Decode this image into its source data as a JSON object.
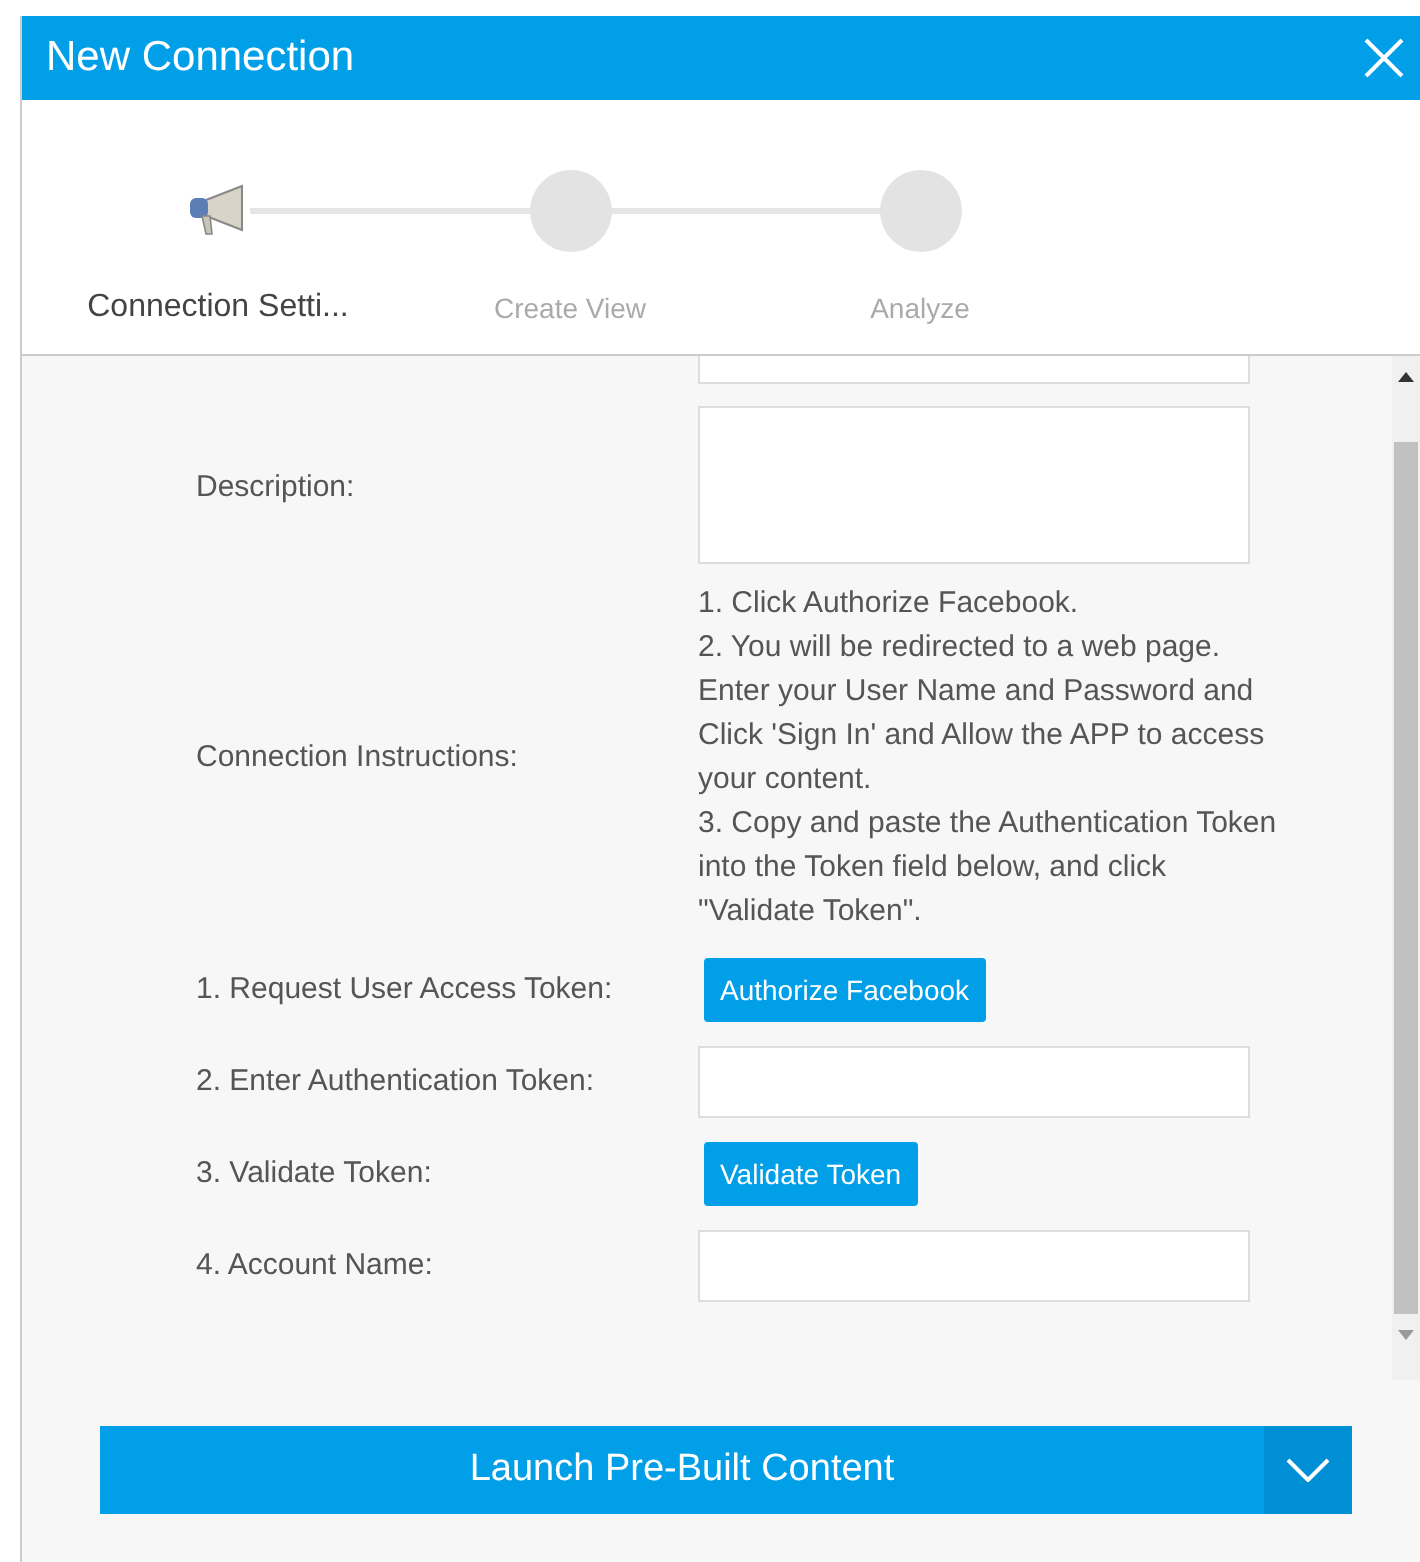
{
  "window": {
    "title": "New Connection"
  },
  "steps": [
    {
      "label": "Connection Setti...",
      "selected": true
    },
    {
      "label": "Create View",
      "selected": false
    },
    {
      "label": "Analyze",
      "selected": false
    }
  ],
  "form": {
    "description_label": "Description:",
    "instructions_label": "Connection Instructions:",
    "instructions": [
      "1. Click Authorize Facebook.",
      "2. You will be redirected to a web page. Enter your User Name and Password and Click 'Sign In' and Allow the APP to access your content.",
      "3. Copy and paste the Authentication Token into the Token field below, and click \"Validate Token\"."
    ],
    "rows": [
      {
        "kind": "button",
        "label": "1. Request User Access Token:",
        "button": "Authorize Facebook"
      },
      {
        "kind": "field",
        "label": "2. Enter Authentication Token:"
      },
      {
        "kind": "button",
        "label": "3. Validate Token:",
        "button": "Validate Token"
      },
      {
        "kind": "field",
        "label": "4. Account Name:"
      }
    ]
  },
  "launch_button": "Launch Pre-Built Content"
}
